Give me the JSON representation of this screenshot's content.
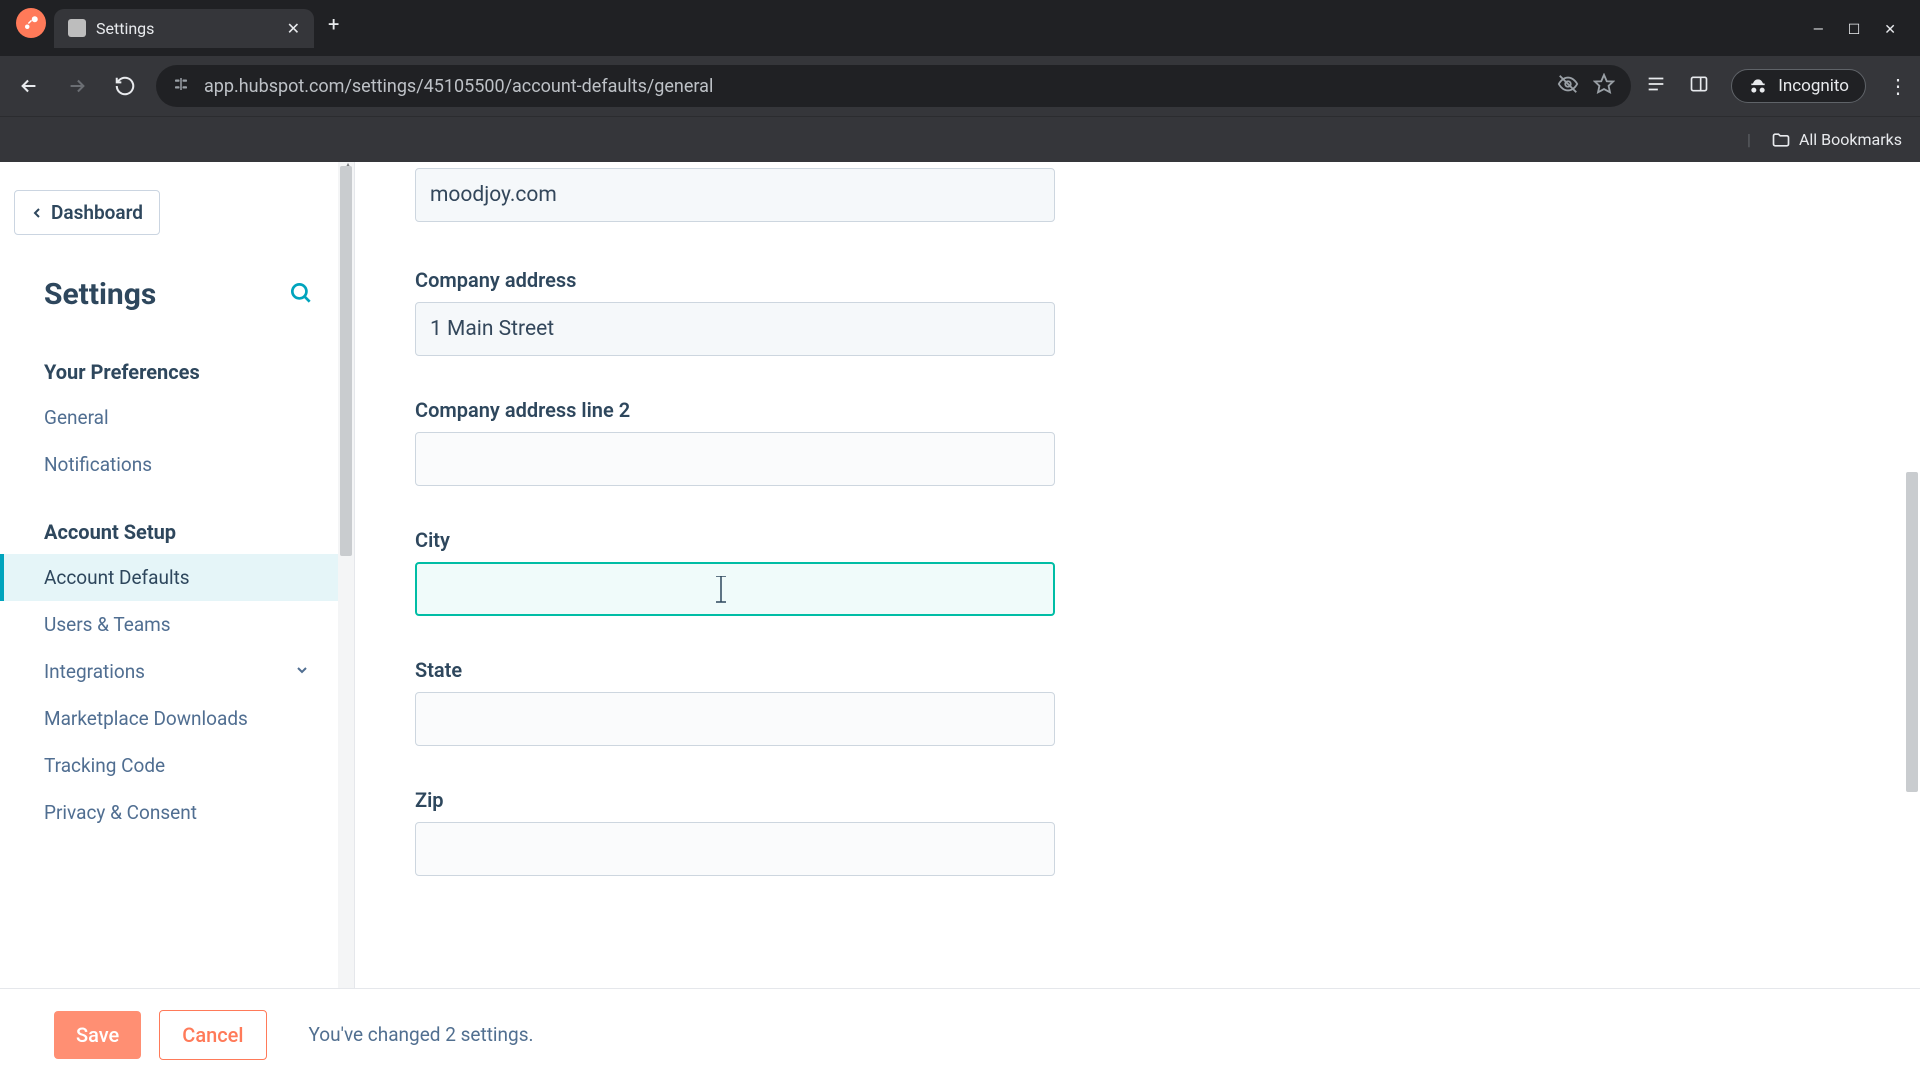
{
  "browser": {
    "tab_title": "Settings",
    "url": "app.hubspot.com/settings/45105500/account-defaults/general",
    "incognito_label": "Incognito",
    "bookmarks_label": "All Bookmarks"
  },
  "sidebar": {
    "back_link": "Dashboard",
    "title": "Settings",
    "sections": {
      "prefs_title": "Your Preferences",
      "setup_title": "Account Setup"
    },
    "items": {
      "general": "General",
      "notifications": "Notifications",
      "account_defaults": "Account Defaults",
      "users_teams": "Users & Teams",
      "integrations": "Integrations",
      "marketplace": "Marketplace Downloads",
      "tracking": "Tracking Code",
      "privacy": "Privacy & Consent"
    }
  },
  "form": {
    "domain": {
      "value": "moodjoy.com"
    },
    "address": {
      "label": "Company address",
      "value": "1 Main Street"
    },
    "address2": {
      "label": "Company address line 2",
      "value": ""
    },
    "city": {
      "label": "City",
      "value": ""
    },
    "state": {
      "label": "State",
      "value": ""
    },
    "zip": {
      "label": "Zip",
      "value": ""
    }
  },
  "footer": {
    "save": "Save",
    "cancel": "Cancel",
    "status": "You've changed 2 settings."
  }
}
